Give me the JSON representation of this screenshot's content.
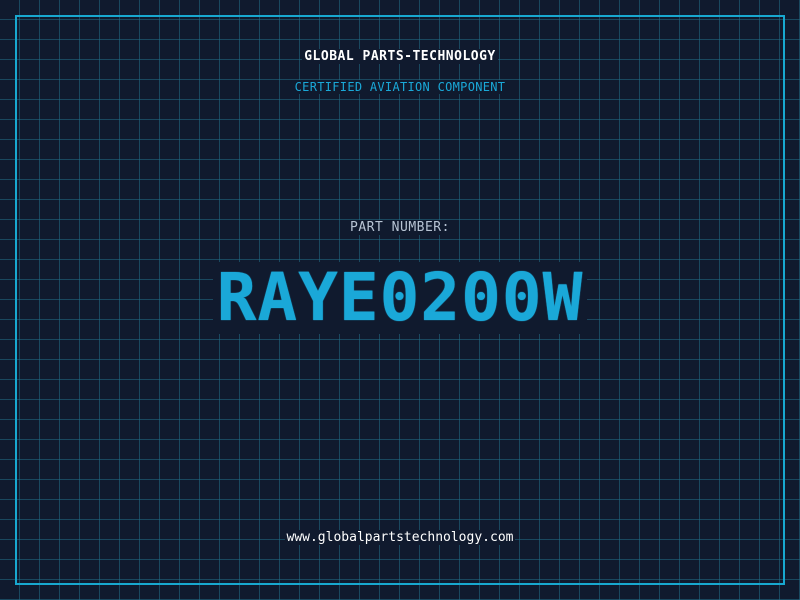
{
  "header": {
    "company": "GLOBAL PARTS-TECHNOLOGY",
    "subtitle": "CERTIFIED AVIATION COMPONENT"
  },
  "main": {
    "part_label": "PART NUMBER:",
    "part_number": "RAYE0200W"
  },
  "footer": {
    "website": "www.globalpartstechnology.com"
  },
  "colors": {
    "background": "#101a2e",
    "accent": "#1aa8d8",
    "grid": "#236e87",
    "text": "#ffffff",
    "muted": "#b8c4d4"
  }
}
